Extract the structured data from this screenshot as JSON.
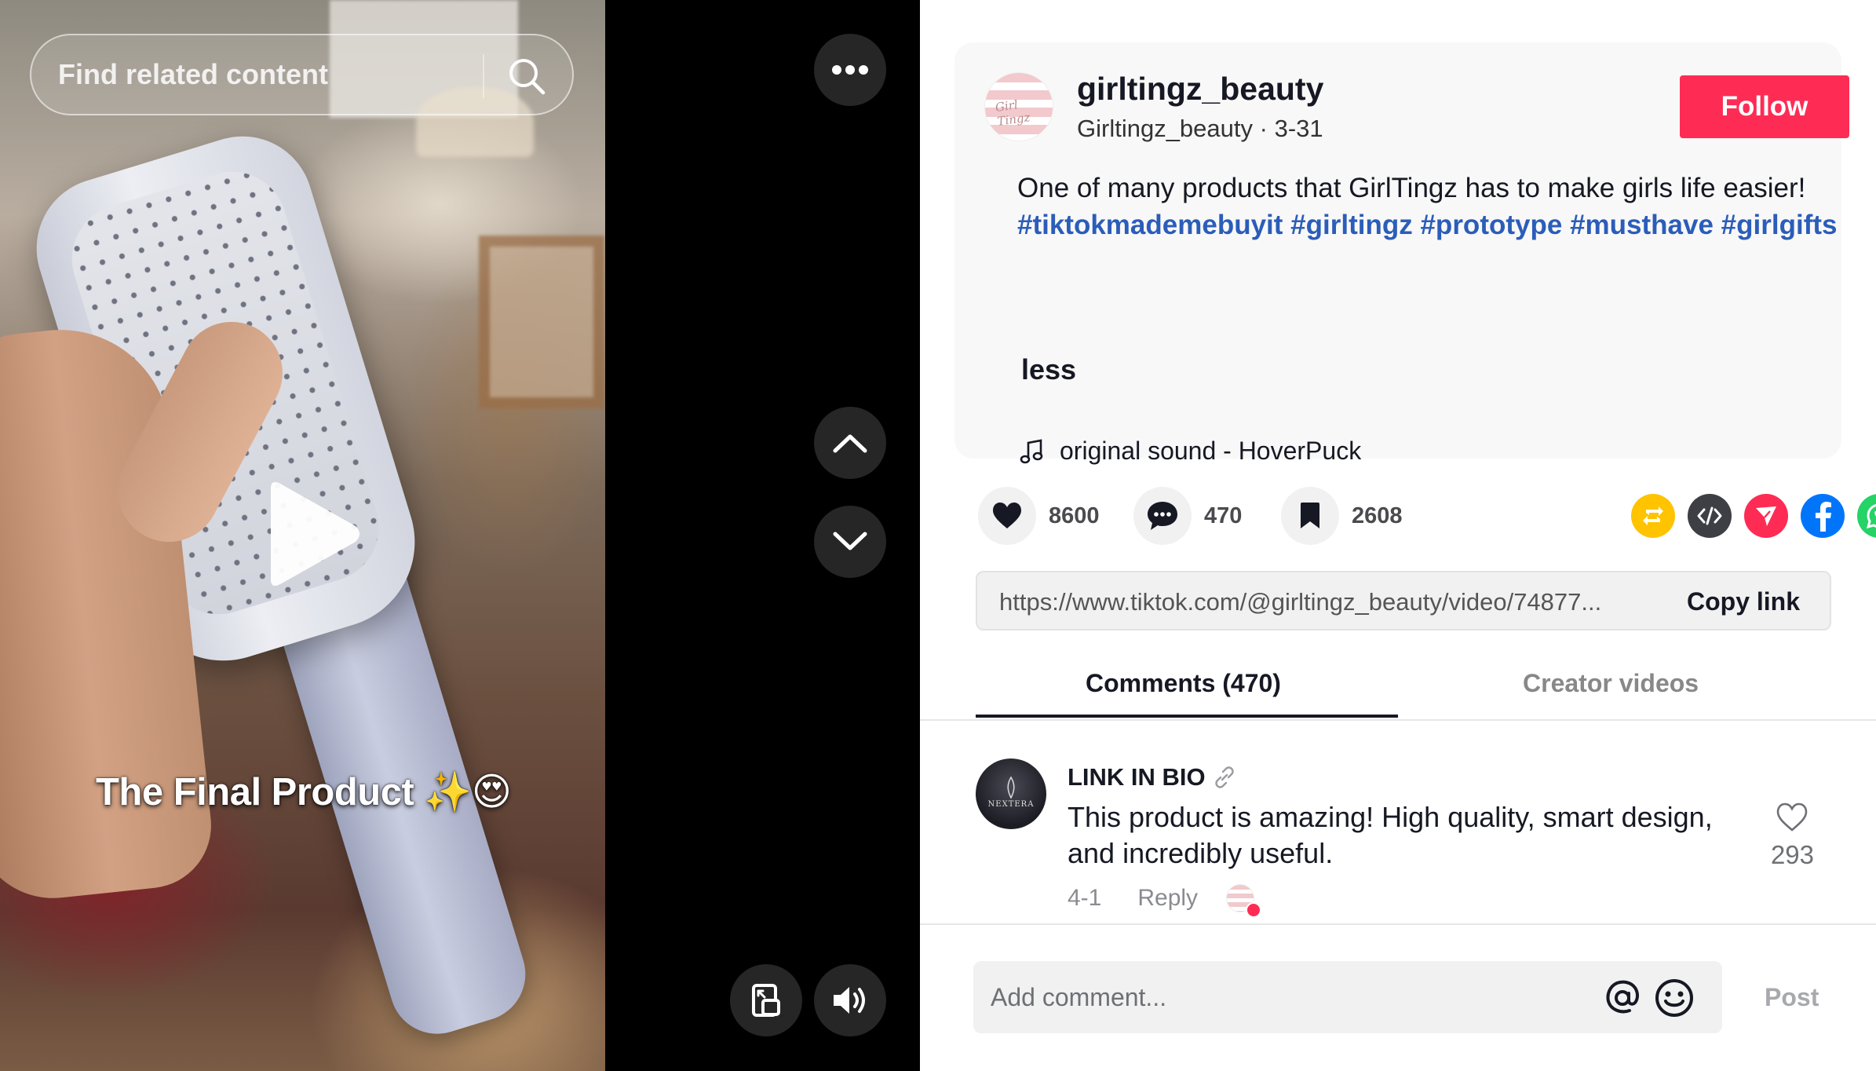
{
  "video": {
    "search_placeholder": "Find related content",
    "caption_text": "The Final Product",
    "caption_emoji": "✨😍",
    "icons": {
      "search": "search-icon",
      "more": "more-icon",
      "prev": "chevron-up-icon",
      "next": "chevron-down-icon",
      "play": "play-icon",
      "miniplayer": "miniplayer-icon",
      "volume": "volume-icon"
    }
  },
  "post": {
    "author_name": "girltingz_beauty",
    "author_nickname": "Girltingz_beauty",
    "date": "3-31",
    "follow_label": "Follow",
    "description": "One of many products that GirlTingz has to make girls life easier!",
    "hashtags": [
      "#tiktokmademebuyit",
      "#girltingz",
      "#prototype",
      "#musthave",
      "#girlgifts"
    ],
    "less_label": "less",
    "music": "original sound - HoverPuck"
  },
  "actions": {
    "likes": "8600",
    "comments": "470",
    "saves": "2608",
    "share_icons": [
      "repost-icon",
      "embed-icon",
      "send-icon",
      "facebook-icon",
      "whatsapp-icon",
      "share-arrow-icon"
    ]
  },
  "share_link": {
    "url": "https://www.tiktok.com/@girltingz_beauty/video/74877...",
    "copy_label": "Copy link"
  },
  "tabs": {
    "comments_label": "Comments (470)",
    "creator_videos_label": "Creator videos"
  },
  "comments": [
    {
      "avatar_text": "NEXTERA",
      "user": "LINK IN BIO",
      "text": "This product is amazing! High quality, smart design, and incredibly useful.",
      "date": "4-1",
      "reply_label": "Reply",
      "likes": "293"
    }
  ],
  "composer": {
    "placeholder": "Add comment...",
    "post_label": "Post"
  },
  "colors": {
    "accent": "#fe2c55",
    "hashtag": "#2b5db9",
    "repost": "#ffc300",
    "embed": "#3d3f45",
    "send": "#fe2c55",
    "facebook": "#0075fa",
    "whatsapp": "#25d366"
  }
}
